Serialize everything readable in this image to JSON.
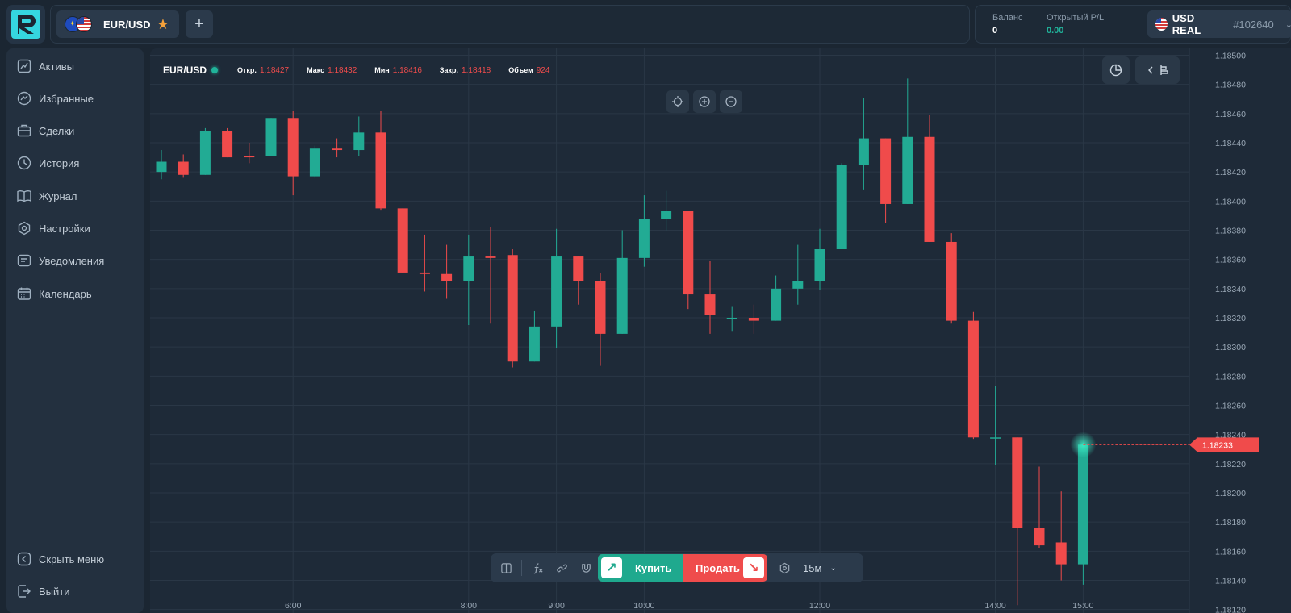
{
  "header": {
    "asset": "EUR/USD",
    "add_label": "+",
    "balance_label": "Баланс",
    "balance_value": "0",
    "pl_label": "Открытый P/L",
    "pl_value": "0.00",
    "account_currency": "USD REAL",
    "account_id": "#102640"
  },
  "sidebar": {
    "items": [
      {
        "label": "Активы",
        "icon": "assets-icon"
      },
      {
        "label": "Избранные",
        "icon": "favorites-icon"
      },
      {
        "label": "Сделки",
        "icon": "deals-icon"
      },
      {
        "label": "История",
        "icon": "history-icon"
      },
      {
        "label": "Журнал",
        "icon": "journal-icon"
      },
      {
        "label": "Настройки",
        "icon": "settings-icon"
      },
      {
        "label": "Уведомления",
        "icon": "notifications-icon"
      },
      {
        "label": "Календарь",
        "icon": "calendar-icon"
      }
    ],
    "hide_menu_label": "Скрыть меню",
    "logout_label": "Выйти"
  },
  "ohlc": {
    "symbol": "EUR/USD",
    "open_label": "Откр.",
    "open": "1.18427",
    "high_label": "Макс",
    "high": "1.18432",
    "low_label": "Мин",
    "low": "1.18416",
    "close_label": "Закр.",
    "close": "1.18418",
    "volume_label": "Объем",
    "volume": "924"
  },
  "tradebar": {
    "buy_label": "Купить",
    "sell_label": "Продать",
    "timeframe": "15м"
  },
  "colors": {
    "up": "#22ab94",
    "down": "#f04b4b",
    "background": "#1e2a38",
    "grid": "#2a3746"
  },
  "chart_data": {
    "type": "candlestick",
    "symbol": "EUR/USD",
    "timeframe": "15м",
    "current_price": "1.18233",
    "y_ticks": [
      "1.18500",
      "1.18480",
      "1.18460",
      "1.18440",
      "1.18420",
      "1.18400",
      "1.18380",
      "1.18360",
      "1.18340",
      "1.18320",
      "1.18300",
      "1.18280",
      "1.18260",
      "1.18240",
      "1.18220",
      "1.18200",
      "1.18180",
      "1.18160",
      "1.18140",
      "1.18120"
    ],
    "x_ticks": [
      {
        "label": "6:00",
        "index": 6
      },
      {
        "label": "8:00",
        "index": 14
      },
      {
        "label": "9:00",
        "index": 18
      },
      {
        "label": "10:00",
        "index": 22
      },
      {
        "label": "12:00",
        "index": 30
      },
      {
        "label": "14:00",
        "index": 38
      },
      {
        "label": "15:00",
        "index": 42
      }
    ],
    "ylim": [
      1.18115,
      1.18505
    ],
    "candles": [
      {
        "o": 1.1842,
        "h": 1.18435,
        "l": 1.18415,
        "c": 1.18427
      },
      {
        "o": 1.18427,
        "h": 1.18432,
        "l": 1.18416,
        "c": 1.18418
      },
      {
        "o": 1.18418,
        "h": 1.1845,
        "l": 1.18418,
        "c": 1.18448
      },
      {
        "o": 1.18448,
        "h": 1.1845,
        "l": 1.1843,
        "c": 1.1843
      },
      {
        "o": 1.18431,
        "h": 1.1844,
        "l": 1.18426,
        "c": 1.1843
      },
      {
        "o": 1.18431,
        "h": 1.18457,
        "l": 1.18431,
        "c": 1.18457
      },
      {
        "o": 1.18457,
        "h": 1.18462,
        "l": 1.18404,
        "c": 1.18417
      },
      {
        "o": 1.18417,
        "h": 1.18438,
        "l": 1.18416,
        "c": 1.18436
      },
      {
        "o": 1.18436,
        "h": 1.18443,
        "l": 1.1843,
        "c": 1.18435
      },
      {
        "o": 1.18435,
        "h": 1.18458,
        "l": 1.18431,
        "c": 1.18447
      },
      {
        "o": 1.18447,
        "h": 1.18462,
        "l": 1.18394,
        "c": 1.18395
      },
      {
        "o": 1.18395,
        "h": 1.18395,
        "l": 1.18351,
        "c": 1.18351
      },
      {
        "o": 1.18351,
        "h": 1.18377,
        "l": 1.18338,
        "c": 1.1835
      },
      {
        "o": 1.1835,
        "h": 1.1837,
        "l": 1.18333,
        "c": 1.18345
      },
      {
        "o": 1.18345,
        "h": 1.18377,
        "l": 1.18315,
        "c": 1.18362
      },
      {
        "o": 1.18362,
        "h": 1.18382,
        "l": 1.18316,
        "c": 1.18361
      },
      {
        "o": 1.18363,
        "h": 1.18367,
        "l": 1.18286,
        "c": 1.1829
      },
      {
        "o": 1.1829,
        "h": 1.18325,
        "l": 1.1829,
        "c": 1.18314
      },
      {
        "o": 1.18314,
        "h": 1.18381,
        "l": 1.18299,
        "c": 1.18362
      },
      {
        "o": 1.18362,
        "h": 1.18362,
        "l": 1.18329,
        "c": 1.18345
      },
      {
        "o": 1.18345,
        "h": 1.18351,
        "l": 1.18287,
        "c": 1.18309
      },
      {
        "o": 1.18309,
        "h": 1.1838,
        "l": 1.18309,
        "c": 1.18361
      },
      {
        "o": 1.18361,
        "h": 1.18404,
        "l": 1.18355,
        "c": 1.18388
      },
      {
        "o": 1.18388,
        "h": 1.18407,
        "l": 1.1838,
        "c": 1.18393
      },
      {
        "o": 1.18393,
        "h": 1.18393,
        "l": 1.18326,
        "c": 1.18336
      },
      {
        "o": 1.18336,
        "h": 1.18359,
        "l": 1.18309,
        "c": 1.18322
      },
      {
        "o": 1.1832,
        "h": 1.18328,
        "l": 1.18311,
        "c": 1.1832
      },
      {
        "o": 1.1832,
        "h": 1.18329,
        "l": 1.18309,
        "c": 1.18318
      },
      {
        "o": 1.18318,
        "h": 1.18349,
        "l": 1.18318,
        "c": 1.1834
      },
      {
        "o": 1.1834,
        "h": 1.1837,
        "l": 1.18329,
        "c": 1.18345
      },
      {
        "o": 1.18345,
        "h": 1.18381,
        "l": 1.18339,
        "c": 1.18367
      },
      {
        "o": 1.18367,
        "h": 1.18426,
        "l": 1.18367,
        "c": 1.18425
      },
      {
        "o": 1.18425,
        "h": 1.18471,
        "l": 1.18408,
        "c": 1.18443
      },
      {
        "o": 1.18443,
        "h": 1.18443,
        "l": 1.18385,
        "c": 1.18398
      },
      {
        "o": 1.18398,
        "h": 1.18484,
        "l": 1.18398,
        "c": 1.18444
      },
      {
        "o": 1.18444,
        "h": 1.18459,
        "l": 1.18372,
        "c": 1.18372
      },
      {
        "o": 1.18372,
        "h": 1.18378,
        "l": 1.18316,
        "c": 1.18318
      },
      {
        "o": 1.18318,
        "h": 1.18324,
        "l": 1.18237,
        "c": 1.18238
      },
      {
        "o": 1.18238,
        "h": 1.18273,
        "l": 1.18219,
        "c": 1.18238
      },
      {
        "o": 1.18238,
        "h": 1.18238,
        "l": 1.18123,
        "c": 1.18176
      },
      {
        "o": 1.18176,
        "h": 1.18218,
        "l": 1.18162,
        "c": 1.18164
      },
      {
        "o": 1.18166,
        "h": 1.18201,
        "l": 1.1814,
        "c": 1.18151
      },
      {
        "o": 1.18151,
        "h": 1.18234,
        "l": 1.18137,
        "c": 1.18233
      }
    ]
  }
}
